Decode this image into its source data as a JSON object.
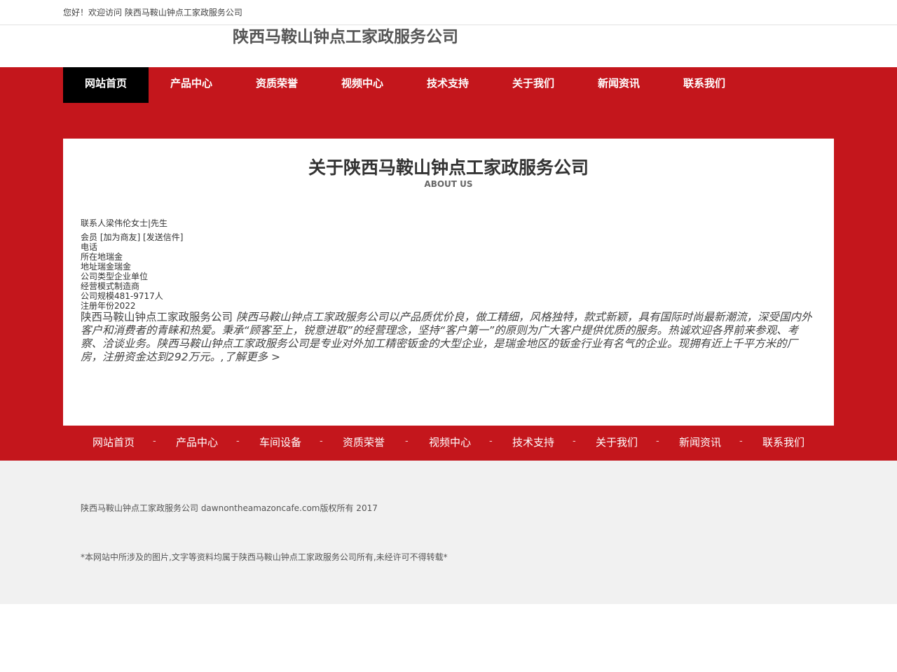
{
  "header": {
    "welcome": "您好！欢迎访问 陕西马鞍山钟点工家政服务公司",
    "site_title": "陕西马鞍山钟点工家政服务公司"
  },
  "nav": {
    "items": [
      "网站首页",
      "产品中心",
      "资质荣誉",
      "视频中心",
      "技术支持",
      "关于我们",
      "新闻资讯",
      "联系我们"
    ],
    "active_index": 0,
    "colors": {
      "bar": "#c4161c",
      "active": "#000000"
    }
  },
  "about": {
    "title": "关于陕西马鞍山钟点工家政服务公司",
    "subtitle": "ABOUT US",
    "contact": "联系人梁伟伦女士|先生",
    "member_label": "会员",
    "add_friend": "[加为商友]",
    "send_mail": "[发送信件]",
    "phone": "电话",
    "location": "所在地瑞金",
    "address": "地址瑞金瑞金",
    "company_type": "公司类型企业单位",
    "business_model": "经营模式制造商",
    "company_size": "公司规模481-9717人",
    "registered_year": "注册年份2022",
    "company_name": "陕西马鞍山钟点工家政服务公司",
    "description": "陕西马鞍山钟点工家政服务公司以产品质优价良，做工精细，风格独特，款式新颖，具有国际时尚最新潮流，深受国内外客户和消费者的青睐和热爱。秉承“顾客至上，锐意进取”的经营理念，坚持“客户第一”的原则为广大客户提供优质的服务。热诚欢迎各界前来参观、考察、洽谈业务。陕西马鞍山钟点工家政服务公司是专业对外加工精密钣金的大型企业，是瑞金地区的钣金行业有名气的企业。现拥有近上千平方米的厂房，注册资金达到292万元。,",
    "more_link": "了解更多 >"
  },
  "footer_nav": {
    "items": [
      "网站首页",
      "产品中心",
      "车间设备",
      "资质荣誉",
      "视频中心",
      "技术支持",
      "关于我们",
      "新闻资讯",
      "联系我们"
    ],
    "separator": "-"
  },
  "footer": {
    "copyright": "陕西马鞍山钟点工家政服务公司 dawnontheamazoncafe.com版权所有 2017",
    "notice": "*本网站中所涉及的图片,文字等资料均属于陕西马鞍山钟点工家政服务公司所有,未经许可不得转载*"
  }
}
